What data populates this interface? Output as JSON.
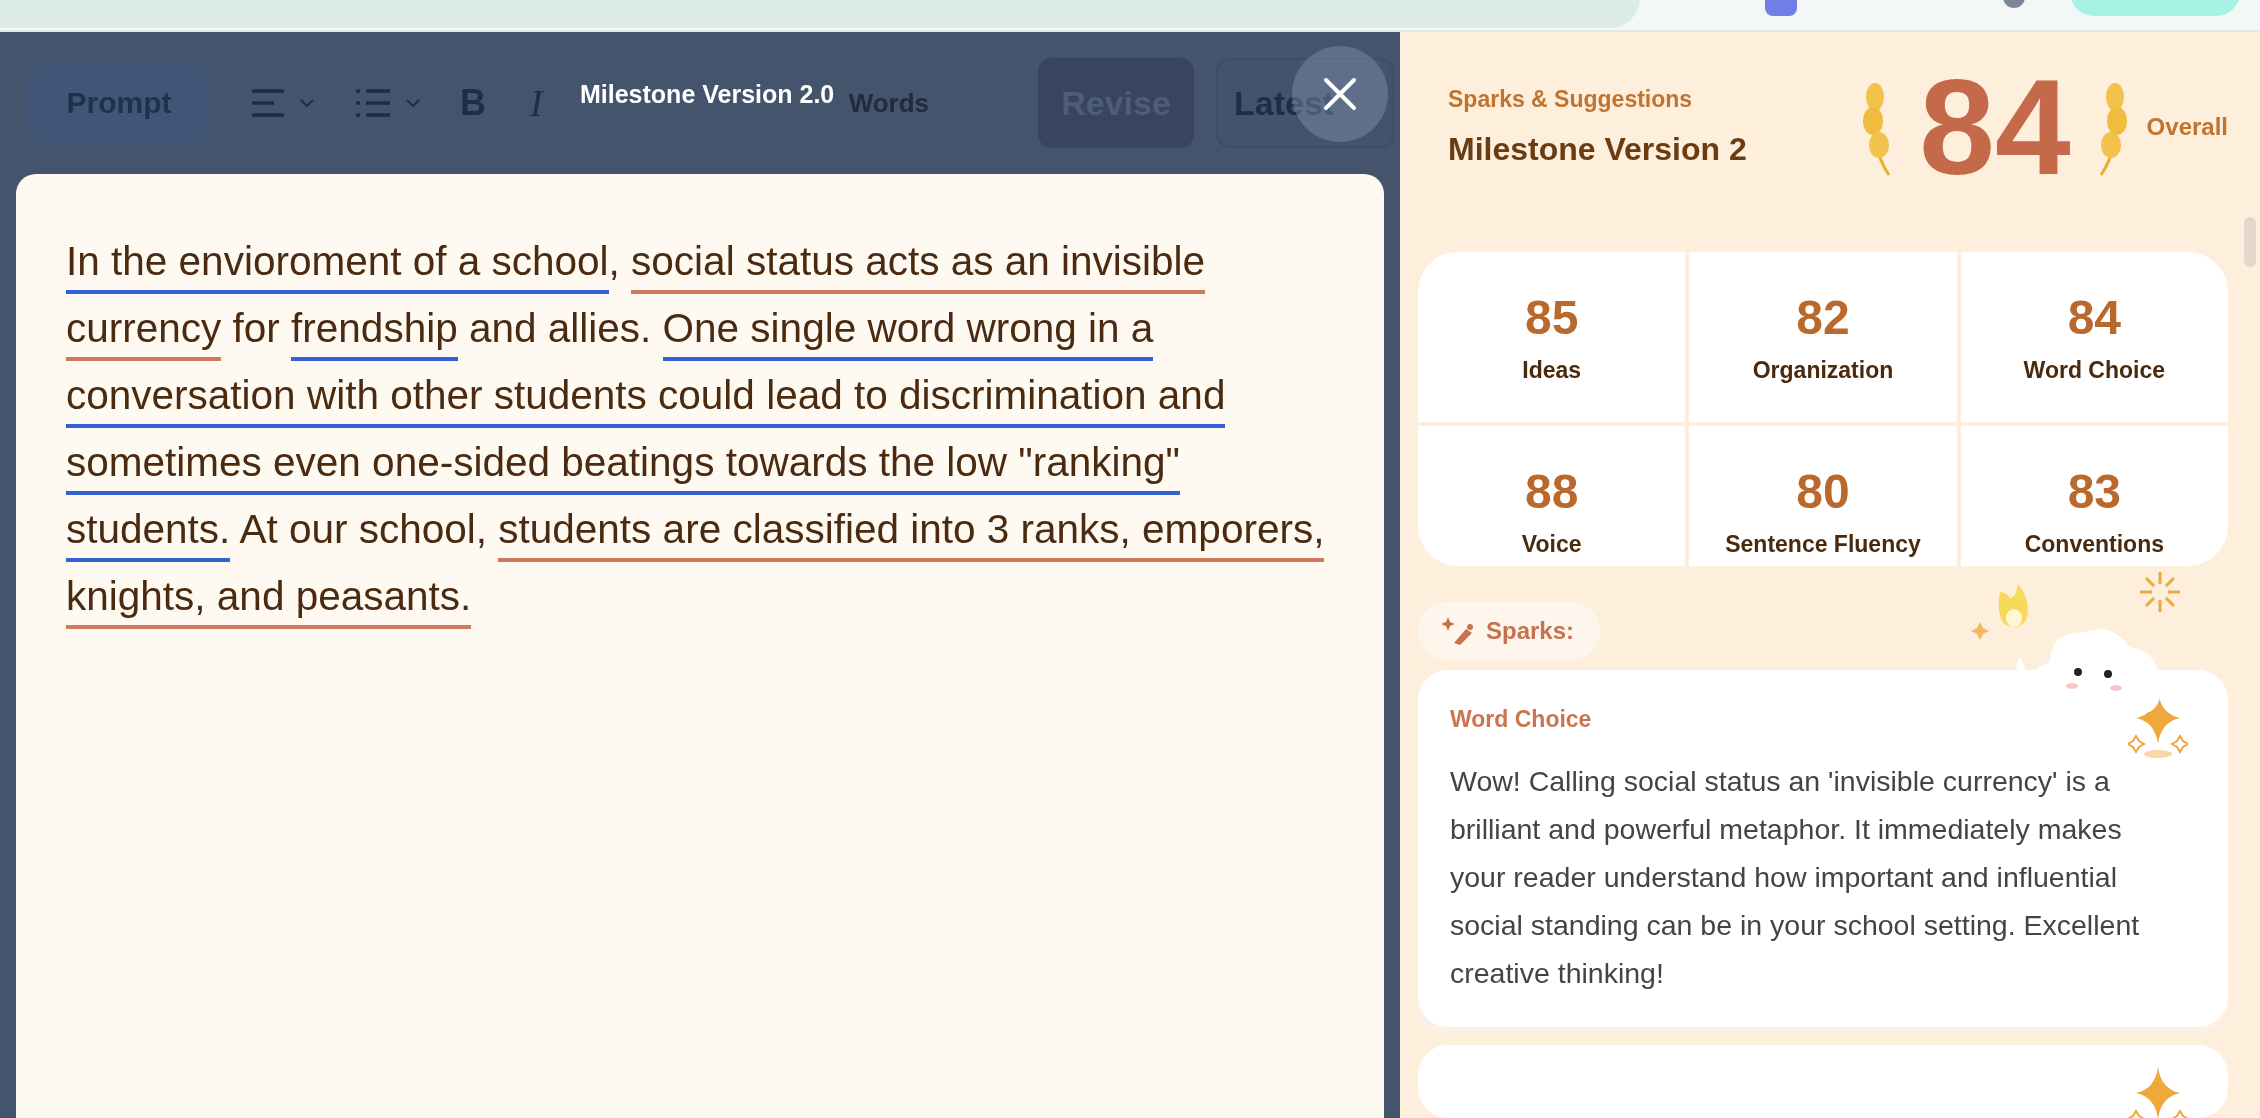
{
  "dialog": {
    "title": "Milestone Version 2.0"
  },
  "toolbar": {
    "buttons": [
      {
        "kind": "text",
        "label": "Prompt"
      },
      {
        "kind": "align"
      },
      {
        "kind": "list"
      },
      {
        "kind": "bold",
        "label": "B"
      },
      {
        "kind": "italic",
        "label": "I"
      }
    ],
    "word_count": "Words",
    "revise": "Revise",
    "version": "Latest"
  },
  "essay": {
    "segments": [
      {
        "text": "In the envioroment of a school",
        "color": "#3462d6"
      },
      {
        "text": ", "
      },
      {
        "text": "social status acts as an invisible currency",
        "color": "#cf7a5a"
      },
      {
        "text": " for "
      },
      {
        "text": "frendship",
        "color": "#3462d6"
      },
      {
        "text": " and allies. "
      },
      {
        "text": "One single word wrong in a conversation with other students could lead to discrimination and sometimes even one-sided beatings towards the low \"ranking\" students.",
        "color": "#3462d6"
      },
      {
        "text": " At our school, "
      },
      {
        "text": "students are classified into 3 ranks, emporers, knights, and peasants.",
        "color": "#cf7a5a"
      }
    ]
  },
  "panel": {
    "eyebrow": "Sparks & Suggestions",
    "title": "Milestone Version 2",
    "overall_score": "84",
    "overall_label": "Overall"
  },
  "scores": [
    {
      "value": "85",
      "label": "Ideas"
    },
    {
      "value": "82",
      "label": "Organization"
    },
    {
      "value": "84",
      "label": "Word Choice"
    },
    {
      "value": "88",
      "label": "Voice"
    },
    {
      "value": "80",
      "label": "Sentence Fluency"
    },
    {
      "value": "83",
      "label": "Conventions"
    }
  ],
  "sparks_label": "Sparks:",
  "spark_cards": [
    {
      "title": "Word Choice",
      "body": "Wow! Calling social status an 'invisible currency' is a brilliant and powerful metaphor. It immediately makes your reader understand how important and influential social standing can be in your school setting. Excellent creative thinking!"
    }
  ]
}
